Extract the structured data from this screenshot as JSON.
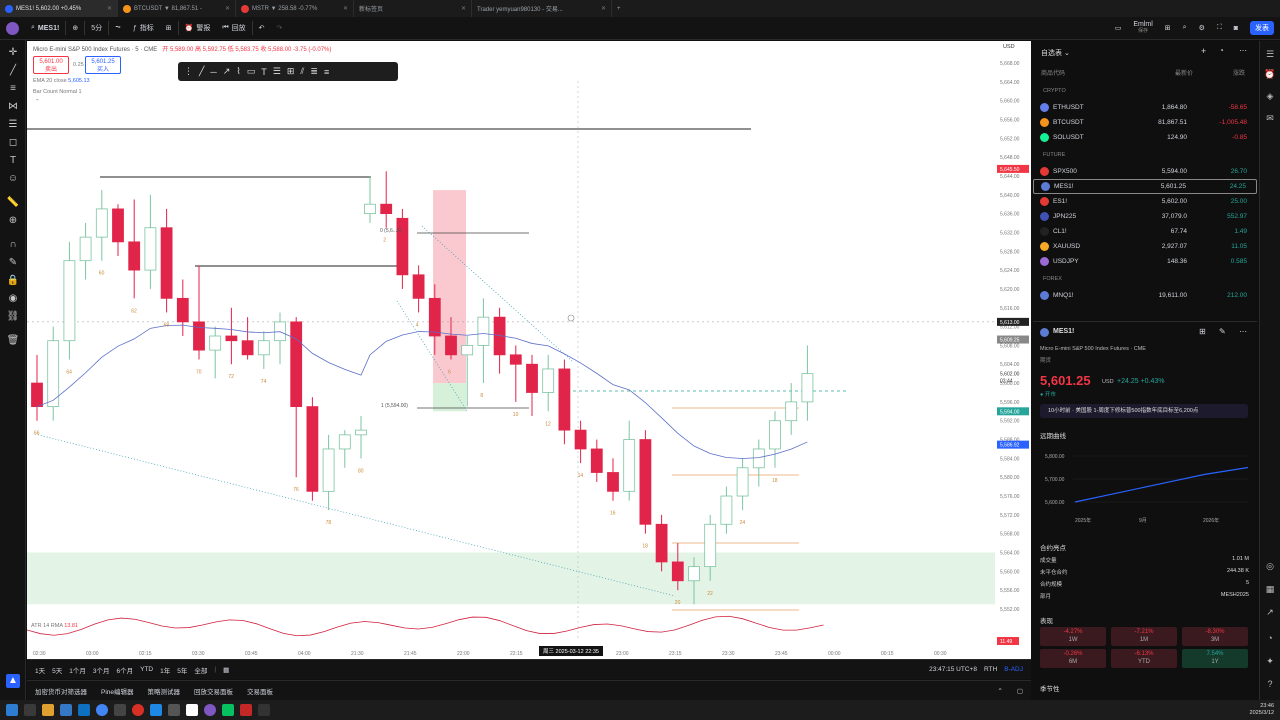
{
  "browser_tabs": [
    {
      "title": "MES1! 5,602.00 +0.45%",
      "active": true
    },
    {
      "title": "BTCUSDT ▼ 81,867.51 -",
      "active": false
    },
    {
      "title": "MSTR ▼ 258.58 -0.77%",
      "active": false
    },
    {
      "title": "新标签页",
      "active": false
    },
    {
      "title": "Trader yemyuan980130 - 交易...",
      "active": false
    }
  ],
  "toolbar": {
    "symbol": "MES1!",
    "interval": "5分",
    "indicators": "指标",
    "alert": "警报",
    "replay": "回放",
    "layout_name": "Emlml",
    "layout_sub": "保存",
    "publish": "发表"
  },
  "chart": {
    "title": "Micro E-mini S&P 500 Index Futures · 5 · CME",
    "ohlc": "开 5,589.00  高 5,592.75  低 5,583.75  收 5,588.00  -3.75 (-0.07%)",
    "sell_price": "5,601.00",
    "sell_label": "卖出",
    "spread": "0.25",
    "buy_price": "5,601.25",
    "buy_label": "买入",
    "ema_label": "EMA 20 close",
    "ema_value": "5,605.13",
    "bar_count_label": "Bar Count Normal 1",
    "currency": "USD",
    "fib_0": "0 (5,6...5)",
    "fib_1": "1 (5,594.00)",
    "price_axis": [
      "5,668.00",
      "5,664.00",
      "5,660.00",
      "5,656.00",
      "5,652.00",
      "5,648.00",
      "5,644.00",
      "5,640.00",
      "5,636.00",
      "5,632.00",
      "5,628.00",
      "5,624.00",
      "5,620.00",
      "5,616.00",
      "5,612.00",
      "5,608.00",
      "5,604.00",
      "5,600.00",
      "5,596.00",
      "5,592.00",
      "5,588.00",
      "5,584.00",
      "5,580.00",
      "5,576.00",
      "5,572.00",
      "5,568.00",
      "5,564.00",
      "5,560.00",
      "5,556.00",
      "5,552.00"
    ],
    "time_axis": [
      "02:30",
      "03:00",
      "02:15",
      "03:30",
      "03:45",
      "04:00",
      "21:30",
      "21:45",
      "22:00",
      "22:15",
      "22:30",
      "23:00",
      "23:15",
      "23:30",
      "23:45",
      "00:00",
      "00:15",
      "00:30"
    ],
    "crosshair_time": "周三 2025-03-12  22:35",
    "badges": {
      "b1": "5,645.50",
      "b2": "5,613.00",
      "b3": "5,609.25",
      "last": "5,602.00",
      "last_time": "02:44",
      "b4": "5,594.00",
      "b5": "5,586.92",
      "atr": "11.49"
    },
    "atr_label": "ATR 14 RMA",
    "atr_value": "13.81",
    "bar_labels": [
      "66",
      "64",
      "60",
      "62",
      "68",
      "70",
      "72",
      "74",
      "76",
      "78",
      "80",
      "2",
      "4",
      "6",
      "8",
      "10",
      "12",
      "14",
      "16",
      "18",
      "20",
      "22",
      "24",
      "18"
    ],
    "chart_data": {
      "type": "candlestick",
      "ohlc": [
        [
          5600,
          5606,
          5592,
          5595
        ],
        [
          5595,
          5612,
          5592,
          5609
        ],
        [
          5609,
          5630,
          5605,
          5626
        ],
        [
          5626,
          5634,
          5622,
          5631
        ],
        [
          5631,
          5641,
          5626,
          5637
        ],
        [
          5637,
          5638,
          5627,
          5630
        ],
        [
          5630,
          5639,
          5618,
          5624
        ],
        [
          5624,
          5640,
          5620,
          5633
        ],
        [
          5633,
          5637,
          5615,
          5618
        ],
        [
          5618,
          5622,
          5610,
          5613
        ],
        [
          5613,
          5625,
          5605,
          5607
        ],
        [
          5607,
          5612,
          5601,
          5610
        ],
        [
          5610,
          5616,
          5604,
          5609
        ],
        [
          5609,
          5614,
          5605,
          5606
        ],
        [
          5606,
          5611,
          5603,
          5609
        ],
        [
          5609,
          5615,
          5604,
          5613
        ],
        [
          5613,
          5614,
          5580,
          5595
        ],
        [
          5595,
          5597,
          5575,
          5577
        ],
        [
          5577,
          5589,
          5573,
          5586
        ],
        [
          5586,
          5590,
          5582,
          5589
        ],
        [
          5589,
          5593,
          5584,
          5590
        ],
        [
          5636,
          5644,
          5634,
          5638
        ],
        [
          5638,
          5645,
          5633,
          5636
        ],
        [
          5635,
          5637,
          5620,
          5623
        ],
        [
          5623,
          5625,
          5615,
          5618
        ],
        [
          5618,
          5621,
          5606,
          5610
        ],
        [
          5610,
          5614,
          5605,
          5606
        ],
        [
          5606,
          5610,
          5595,
          5608
        ],
        [
          5608,
          5618,
          5600,
          5614
        ],
        [
          5614,
          5616,
          5602,
          5606
        ],
        [
          5606,
          5608,
          5596,
          5604
        ],
        [
          5604,
          5606,
          5593,
          5598
        ],
        [
          5598,
          5606,
          5594,
          5603
        ],
        [
          5603,
          5605,
          5587,
          5590
        ],
        [
          5590,
          5592,
          5583,
          5586
        ],
        [
          5586,
          5588,
          5579,
          5581
        ],
        [
          5581,
          5584,
          5575,
          5577
        ],
        [
          5577,
          5592,
          5575,
          5588
        ],
        [
          5588,
          5590,
          5568,
          5570
        ],
        [
          5570,
          5572,
          5560,
          5562
        ],
        [
          5562,
          5566,
          5556,
          5558
        ],
        [
          5558,
          5563,
          5553,
          5561
        ],
        [
          5561,
          5572,
          5558,
          5570
        ],
        [
          5570,
          5578,
          5568,
          5576
        ],
        [
          5576,
          5584,
          5573,
          5582
        ],
        [
          5582,
          5588,
          5578,
          5586
        ],
        [
          5586,
          5594,
          5582,
          5592
        ],
        [
          5592,
          5600,
          5589,
          5596
        ],
        [
          5596,
          5608,
          5592,
          5602
        ]
      ],
      "ema_label": "EMA 20 close"
    }
  },
  "timeframes": [
    "1天",
    "5天",
    "1个月",
    "3个月",
    "6个月",
    "YTD",
    "1年",
    "5年",
    "全部"
  ],
  "clock": "23:47:15 UTC+8",
  "rth": "RTH",
  "adj": "B-ADJ",
  "bottom_tabs": [
    "加密货币对筛选器",
    "Pine编辑器",
    "策略测试器",
    "回放交易面板",
    "交易面板"
  ],
  "watchlist": {
    "title": "自选表",
    "col_symbol": "商品代码",
    "col_last": "最新价",
    "col_change": "涨跌",
    "sections": [
      {
        "name": "CRYPTO",
        "items": [
          {
            "symbol": "ETHUSDT",
            "last": "1,864.80",
            "change": "-58.65",
            "color": "#627eea",
            "neg": true
          },
          {
            "symbol": "BTCUSDT",
            "last": "81,867.51",
            "change": "-1,005.48",
            "color": "#f7931a",
            "neg": true
          },
          {
            "symbol": "SOLUSDT",
            "last": "124.90",
            "change": "-0.85",
            "color": "#14f195",
            "neg": true
          }
        ]
      },
      {
        "name": "FUTURE",
        "items": [
          {
            "symbol": "SPX500",
            "last": "5,594.00",
            "change": "26.70",
            "color": "#e53935",
            "neg": false
          },
          {
            "symbol": "MES1!",
            "last": "5,601.25",
            "change": "24.25",
            "color": "#5b7bd5",
            "neg": false
          },
          {
            "symbol": "ES1!",
            "last": "5,602.00",
            "change": "25.00",
            "color": "#e53935",
            "neg": false
          },
          {
            "symbol": "JPN225",
            "last": "37,079.0",
            "change": "552.97",
            "color": "#3f51b5",
            "neg": false
          },
          {
            "symbol": "CL1!",
            "last": "67.74",
            "change": "1.49",
            "color": "#222",
            "neg": false
          },
          {
            "symbol": "XAUUSD",
            "last": "2,927.07",
            "change": "11.05",
            "color": "#f9a825",
            "neg": false
          },
          {
            "symbol": "USDJPY",
            "last": "148.36",
            "change": "0.585",
            "color": "#9c6ad6",
            "neg": false
          }
        ]
      },
      {
        "name": "FOREX",
        "items": [
          {
            "symbol": "MNQ1!",
            "last": "19,611.00",
            "change": "212.00",
            "color": "#5b7bd5",
            "neg": false
          }
        ]
      }
    ]
  },
  "details": {
    "symbol": "MES1!",
    "name": "Micro E-mini S&P 500 Index Futures",
    "exchange": "CME",
    "type": "期货",
    "price": "5,601.25",
    "currency": "USD",
    "change": "+24.25",
    "change_pct": "+0.43%",
    "status": "开市",
    "news": "10小时前 · 美国股 1-周度下修标普500指数年底目标至6,200点",
    "curve_title": "远期曲线",
    "curve_y": [
      "5,800.00",
      "5,700.00",
      "5,600.00"
    ],
    "curve_x": [
      "2025年",
      "9月",
      "2026年"
    ],
    "contract_title": "合约亮点",
    "stats": [
      {
        "label": "成交量",
        "value": "1.01 M"
      },
      {
        "label": "未平仓合约",
        "value": "244.38 K"
      },
      {
        "label": "合约规模",
        "value": "5"
      },
      {
        "label": "部月",
        "value": "MESH2025"
      }
    ],
    "perf_title": "表现",
    "perf": [
      {
        "v": "-4.27%",
        "p": "1W",
        "neg": true
      },
      {
        "v": "-7.21%",
        "p": "1M",
        "neg": true
      },
      {
        "v": "-8.30%",
        "p": "3M",
        "neg": true
      },
      {
        "v": "-0.26%",
        "p": "6M",
        "neg": true
      },
      {
        "v": "-6.13%",
        "p": "YTD",
        "neg": true
      },
      {
        "v": "7.54%",
        "p": "1Y",
        "neg": false
      }
    ],
    "season_title": "季节性"
  },
  "taskbar": {
    "time": "23:46",
    "date": "2025/3/12"
  },
  "chart_curve": {
    "values": [
      5600,
      5640,
      5680,
      5720,
      5750
    ]
  }
}
